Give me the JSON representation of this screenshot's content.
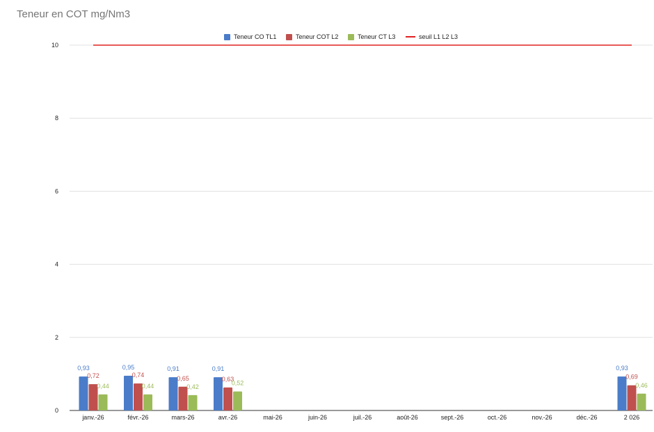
{
  "title": "Teneur en COT mg/Nm3",
  "chart_data": {
    "type": "bar",
    "title": "Teneur en COT mg/Nm3",
    "xlabel": "",
    "ylabel": "",
    "ylim": [
      0,
      10
    ],
    "yticks": [
      0,
      2,
      4,
      6,
      8,
      10
    ],
    "grid": true,
    "legend_position": "top",
    "categories": [
      "janv.-26",
      "févr.-26",
      "mars-26",
      "avr.-26",
      "mai-26",
      "juin-26",
      "juil.-26",
      "août-26",
      "sept.-26",
      "oct.-26",
      "nov.-26",
      "déc.-26",
      "2 026"
    ],
    "series": [
      {
        "name": "Teneur CO TL1",
        "type": "bar",
        "color": "#4a7cc9",
        "values": [
          0.93,
          0.95,
          0.91,
          0.91,
          null,
          null,
          null,
          null,
          null,
          null,
          null,
          null,
          0.93
        ],
        "labels": [
          "0,93",
          "0,95",
          "0,91",
          "0,91",
          "",
          "",
          "",
          "",
          "",
          "",
          "",
          "",
          "0,93"
        ]
      },
      {
        "name": "Teneur COT L2",
        "type": "bar",
        "color": "#c0504d",
        "values": [
          0.72,
          0.74,
          0.65,
          0.63,
          null,
          null,
          null,
          null,
          null,
          null,
          null,
          null,
          0.69
        ],
        "labels": [
          "0,72",
          "0,74",
          "0,65",
          "0,63",
          "",
          "",
          "",
          "",
          "",
          "",
          "",
          "",
          "0,69"
        ]
      },
      {
        "name": "Teneur CT L3",
        "type": "bar",
        "color": "#9bbb59",
        "values": [
          0.44,
          0.44,
          0.42,
          0.52,
          null,
          null,
          null,
          null,
          null,
          null,
          null,
          null,
          0.46
        ],
        "labels": [
          "0,44",
          "0,44",
          "0,42",
          "0,52",
          "",
          "",
          "",
          "",
          "",
          "",
          "",
          "",
          "0,46"
        ]
      },
      {
        "name": "seuil L1 L2 L3",
        "type": "line",
        "color": "#e02020",
        "values": [
          10,
          10,
          10,
          10,
          10,
          10,
          10,
          10,
          10,
          10,
          10,
          10,
          10
        ]
      }
    ]
  }
}
